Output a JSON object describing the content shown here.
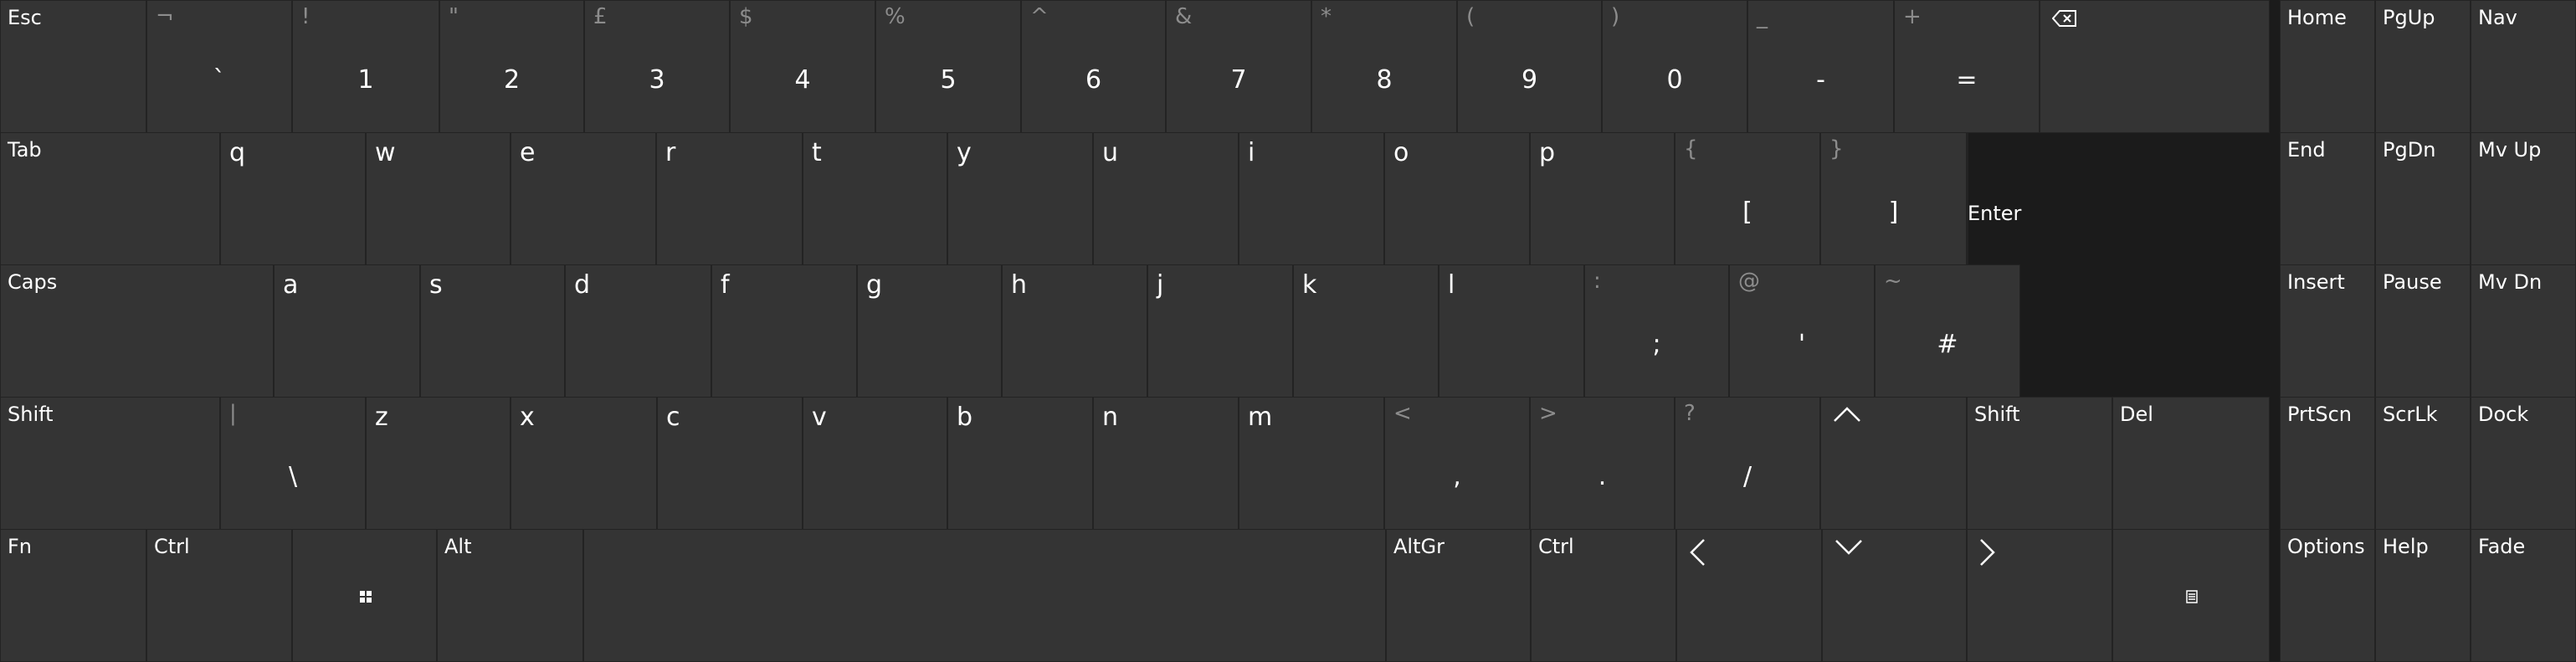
{
  "colors": {
    "background": "#1b1b1b",
    "key": "#343434",
    "secondary_text": "#8c8c8c",
    "text": "#ffffff"
  },
  "row1": [
    {
      "id": "esc",
      "label": "Esc"
    },
    {
      "id": "backtick",
      "shift": "¬",
      "char": "`"
    },
    {
      "id": "1",
      "shift": "!",
      "char": "1"
    },
    {
      "id": "2",
      "shift": "\"",
      "char": "2"
    },
    {
      "id": "3",
      "shift": "£",
      "char": "3"
    },
    {
      "id": "4",
      "shift": "$",
      "char": "4"
    },
    {
      "id": "5",
      "shift": "%",
      "char": "5"
    },
    {
      "id": "6",
      "shift": "^",
      "char": "6"
    },
    {
      "id": "7",
      "shift": "&",
      "char": "7"
    },
    {
      "id": "8",
      "shift": "*",
      "char": "8"
    },
    {
      "id": "9",
      "shift": "(",
      "char": "9"
    },
    {
      "id": "0",
      "shift": ")",
      "char": "0"
    },
    {
      "id": "minus",
      "shift": "_",
      "char": "-"
    },
    {
      "id": "equals",
      "shift": "+",
      "char": "="
    },
    {
      "id": "backspace",
      "icon": "backspace-icon"
    }
  ],
  "row2": [
    {
      "id": "tab",
      "label": "Tab"
    },
    {
      "id": "q",
      "letter": "q"
    },
    {
      "id": "w",
      "letter": "w"
    },
    {
      "id": "e",
      "letter": "e"
    },
    {
      "id": "r",
      "letter": "r"
    },
    {
      "id": "t",
      "letter": "t"
    },
    {
      "id": "y",
      "letter": "y"
    },
    {
      "id": "u",
      "letter": "u"
    },
    {
      "id": "i",
      "letter": "i"
    },
    {
      "id": "o",
      "letter": "o"
    },
    {
      "id": "p",
      "letter": "p"
    },
    {
      "id": "lbracket",
      "shift": "{",
      "char": "["
    },
    {
      "id": "rbracket",
      "shift": "}",
      "char": "]"
    },
    {
      "id": "enter",
      "label": "Enter"
    }
  ],
  "row3": [
    {
      "id": "caps",
      "label": "Caps"
    },
    {
      "id": "a",
      "letter": "a"
    },
    {
      "id": "s",
      "letter": "s"
    },
    {
      "id": "d",
      "letter": "d"
    },
    {
      "id": "f",
      "letter": "f"
    },
    {
      "id": "g",
      "letter": "g"
    },
    {
      "id": "h",
      "letter": "h"
    },
    {
      "id": "j",
      "letter": "j"
    },
    {
      "id": "k",
      "letter": "k"
    },
    {
      "id": "l",
      "letter": "l"
    },
    {
      "id": "semicolon",
      "shift": ":",
      "char": ";"
    },
    {
      "id": "quote",
      "shift": "@",
      "char": "'"
    },
    {
      "id": "hash",
      "shift": "~",
      "char": "#"
    }
  ],
  "row4": [
    {
      "id": "lshift",
      "label": "Shift"
    },
    {
      "id": "backslash",
      "shift": "|",
      "char": "\\"
    },
    {
      "id": "z",
      "letter": "z"
    },
    {
      "id": "x",
      "letter": "x"
    },
    {
      "id": "c",
      "letter": "c"
    },
    {
      "id": "v",
      "letter": "v"
    },
    {
      "id": "b",
      "letter": "b"
    },
    {
      "id": "n",
      "letter": "n"
    },
    {
      "id": "m",
      "letter": "m"
    },
    {
      "id": "comma",
      "shift": "<",
      "char": ","
    },
    {
      "id": "period",
      "shift": ">",
      "char": "."
    },
    {
      "id": "slash",
      "shift": "?",
      "char": "/"
    },
    {
      "id": "up",
      "icon": "arrow-up-icon"
    },
    {
      "id": "rshift",
      "label": "Shift"
    },
    {
      "id": "del",
      "label": "Del"
    }
  ],
  "row5": [
    {
      "id": "fn",
      "label": "Fn"
    },
    {
      "id": "lctrl",
      "label": "Ctrl"
    },
    {
      "id": "win",
      "icon": "windows-logo-icon"
    },
    {
      "id": "alt",
      "label": "Alt"
    },
    {
      "id": "space"
    },
    {
      "id": "altgr",
      "label": "AltGr"
    },
    {
      "id": "rctrl",
      "label": "Ctrl"
    },
    {
      "id": "left",
      "icon": "arrow-left-icon"
    },
    {
      "id": "down",
      "icon": "arrow-down-icon"
    },
    {
      "id": "right",
      "icon": "arrow-right-icon"
    },
    {
      "id": "menu",
      "icon": "context-menu-icon"
    }
  ],
  "nav": [
    {
      "id": "home",
      "label": "Home"
    },
    {
      "id": "pgup",
      "label": "PgUp"
    },
    {
      "id": "nav",
      "label": "Nav"
    },
    {
      "id": "end",
      "label": "End"
    },
    {
      "id": "pgdn",
      "label": "PgDn"
    },
    {
      "id": "mvup",
      "label": "Mv Up"
    },
    {
      "id": "insert",
      "label": "Insert"
    },
    {
      "id": "pause",
      "label": "Pause"
    },
    {
      "id": "mvdn",
      "label": "Mv Dn"
    },
    {
      "id": "prtscn",
      "label": "PrtScn"
    },
    {
      "id": "scrlk",
      "label": "ScrLk"
    },
    {
      "id": "dock",
      "label": "Dock"
    },
    {
      "id": "options",
      "label": "Options"
    },
    {
      "id": "help",
      "label": "Help"
    },
    {
      "id": "fade",
      "label": "Fade"
    }
  ]
}
